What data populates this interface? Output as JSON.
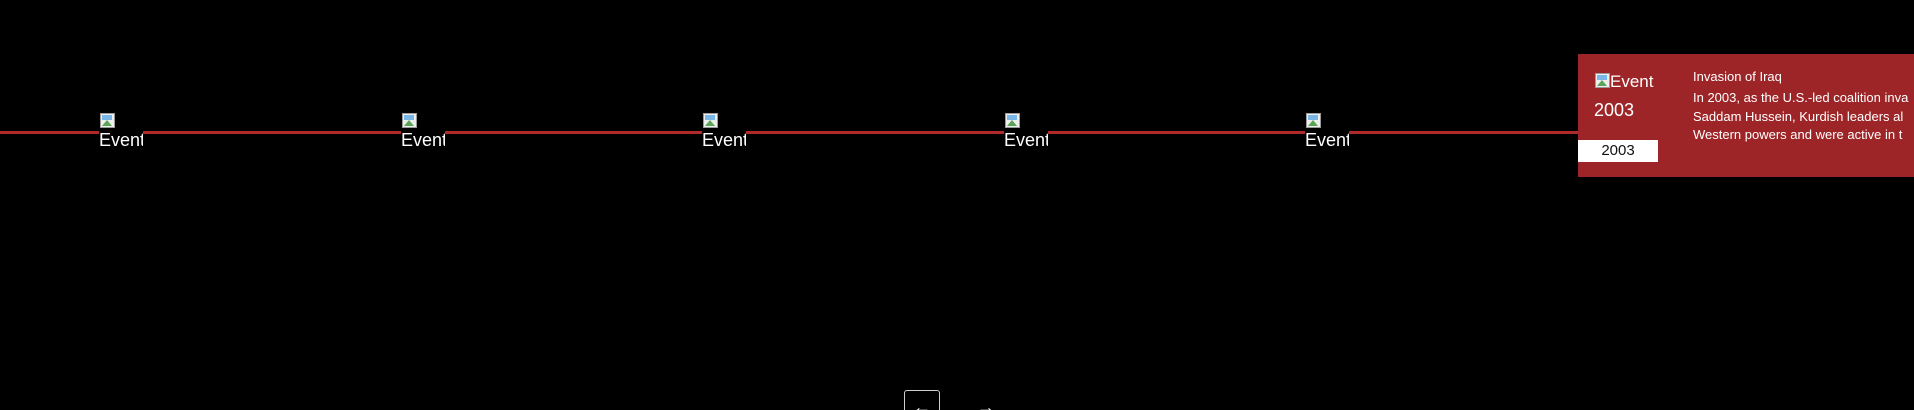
{
  "timeline": {
    "line_color": "#b02a2a",
    "markers": [
      {
        "alt": "Event"
      },
      {
        "alt": "Event"
      },
      {
        "alt": "Event"
      },
      {
        "alt": "Event"
      },
      {
        "alt": "Event"
      }
    ]
  },
  "detail": {
    "background_color": "#9e2527",
    "image_alt": "Event",
    "year_large": "2003",
    "year_badge": "2003",
    "title": "Invasion of Iraq",
    "body_lines": [
      "In 2003, as the U.S.-led coalition inva",
      "Saddam Hussein, Kurdish leaders al",
      "Western powers and were active in t"
    ]
  },
  "navigation": {
    "prev_label": "←",
    "next_label": "→"
  }
}
